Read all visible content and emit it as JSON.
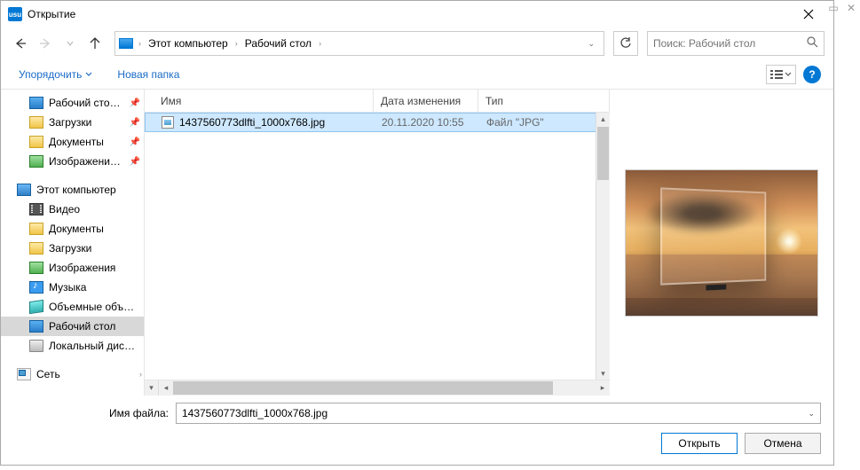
{
  "window": {
    "title": "Открытие",
    "app_icon_text": "usu"
  },
  "nav": {
    "crumbs": [
      "Этот компьютер",
      "Рабочий стол"
    ],
    "search_placeholder": "Поиск: Рабочий стол"
  },
  "toolbar": {
    "organize": "Упорядочить",
    "new_folder": "Новая папка"
  },
  "tree": {
    "quick": [
      {
        "label": "Рабочий сто…",
        "icon": "desktop",
        "pinned": true
      },
      {
        "label": "Загрузки",
        "icon": "folder",
        "pinned": true
      },
      {
        "label": "Документы",
        "icon": "folder",
        "pinned": true
      },
      {
        "label": "Изображени…",
        "icon": "image",
        "pinned": true
      }
    ],
    "pc_label": "Этот компьютер",
    "pc_items": [
      {
        "label": "Видео",
        "icon": "video"
      },
      {
        "label": "Документы",
        "icon": "folder"
      },
      {
        "label": "Загрузки",
        "icon": "folder"
      },
      {
        "label": "Изображения",
        "icon": "image"
      },
      {
        "label": "Музыка",
        "icon": "music"
      },
      {
        "label": "Объемные объ…",
        "icon": "obj3d"
      },
      {
        "label": "Рабочий стол",
        "icon": "desktop",
        "selected": true
      },
      {
        "label": "Локальный дис…",
        "icon": "disk"
      }
    ],
    "network_label": "Сеть"
  },
  "columns": {
    "name": "Имя",
    "date": "Дата изменения",
    "type": "Тип"
  },
  "files": [
    {
      "name": "1437560773dlfti_1000x768.jpg",
      "date": "20.11.2020 10:55",
      "type": "Файл \"JPG\"",
      "selected": true
    }
  ],
  "filename": {
    "label": "Имя файла:",
    "value": "1437560773dlfti_1000x768.jpg"
  },
  "buttons": {
    "open": "Открыть",
    "cancel": "Отмена"
  }
}
